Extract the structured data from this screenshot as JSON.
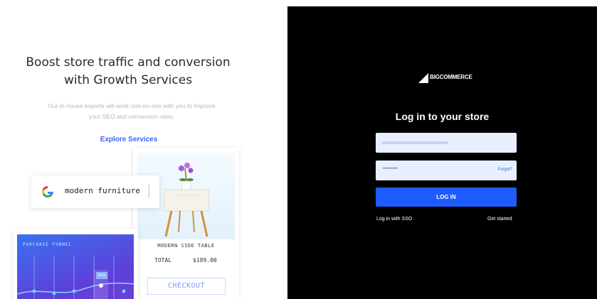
{
  "promo": {
    "title_line1": "Boost store traffic and conversion",
    "title_line2": "with Growth Services",
    "desc_line1": "Our in-house experts will work one-on-one with you to improve",
    "desc_line2": "your SEO and conversion rates.",
    "explore_link": "Explore Services"
  },
  "search_card": {
    "query": "modern furniture",
    "icon": "google-icon"
  },
  "product_card": {
    "name": "MODERN SIDE TABLE",
    "total_label": "TOTAL",
    "total_value": "$189.00",
    "checkout_label": "CHECKOUT"
  },
  "funnel_card": {
    "title": "PURCHASE FUNNEL",
    "percent": "82%"
  },
  "login": {
    "brand": "BIGCOMMERCE",
    "title": "Log in to your store",
    "password_mask": "••••••••••",
    "forgot_label": "Forgot?",
    "login_button": "LOG IN",
    "sso_link": "Log in with SSO",
    "get_started_link": "Get started"
  },
  "colors": {
    "accent": "#1f5cff",
    "link": "#3c64f4",
    "panel_bg": "#000000"
  }
}
